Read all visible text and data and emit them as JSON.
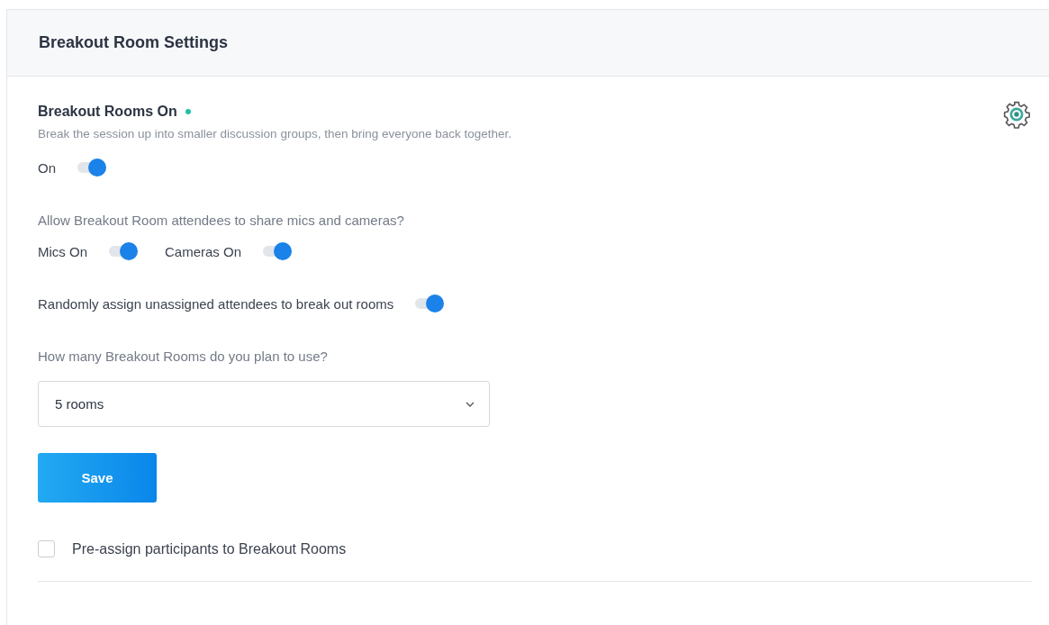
{
  "panel": {
    "title": "Breakout Room Settings"
  },
  "section": {
    "title": "Breakout Rooms On",
    "status_active": true,
    "description": "Break the session up into smaller discussion groups, then bring everyone back together."
  },
  "main_toggle": {
    "label": "On",
    "on": true
  },
  "share_question": "Allow Breakout Room attendees to share mics and cameras?",
  "share_toggles": [
    {
      "label": "Mics On",
      "on": true
    },
    {
      "label": "Cameras On",
      "on": true
    }
  ],
  "random_assign": {
    "label": "Randomly assign unassigned attendees to break out rooms",
    "on": true
  },
  "rooms_question": "How many Breakout Rooms do you plan to use?",
  "rooms_select": {
    "value": "5 rooms"
  },
  "save_button": "Save",
  "preassign": {
    "label": "Pre-assign participants to Breakout Rooms",
    "checked": false
  }
}
